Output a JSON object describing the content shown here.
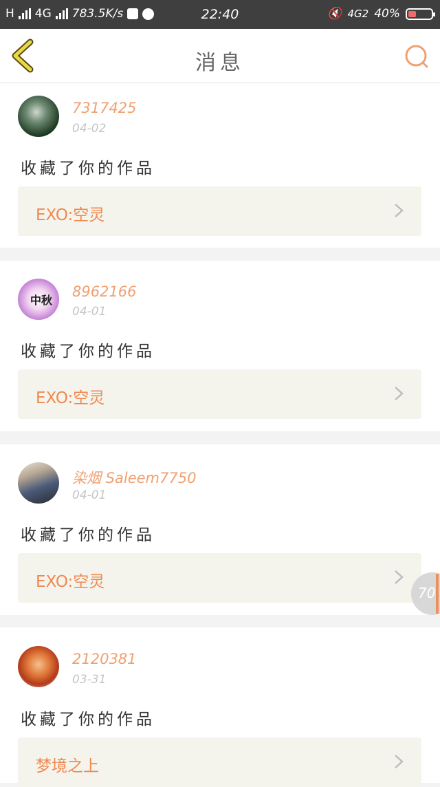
{
  "status_bar": {
    "network": "H",
    "network2": "4G",
    "speed": "783.5K/s",
    "time": "22:40",
    "signal_right": "4G2",
    "battery": "40%"
  },
  "header": {
    "title": "消息"
  },
  "items": [
    {
      "username": "7317425",
      "date": "04-02",
      "action": "收藏了你的作品",
      "work_title": "EXO:空灵"
    },
    {
      "username": "8962166",
      "date": "04-01",
      "action": "收藏了你的作品",
      "work_title": "EXO:空灵"
    },
    {
      "username": "染烟 Saleem7750",
      "date": "04-01",
      "action": "收藏了你的作品",
      "work_title": "EXO:空灵"
    },
    {
      "username": "2120381",
      "date": "03-31",
      "action": "收藏了你的作品",
      "work_title": "梦境之上"
    }
  ],
  "side_badge": {
    "value": "70"
  },
  "colors": {
    "accent": "#f08850",
    "username": "#f0a070",
    "statusbar": "#3f3f3f",
    "back_icon": "#e8d84a"
  }
}
